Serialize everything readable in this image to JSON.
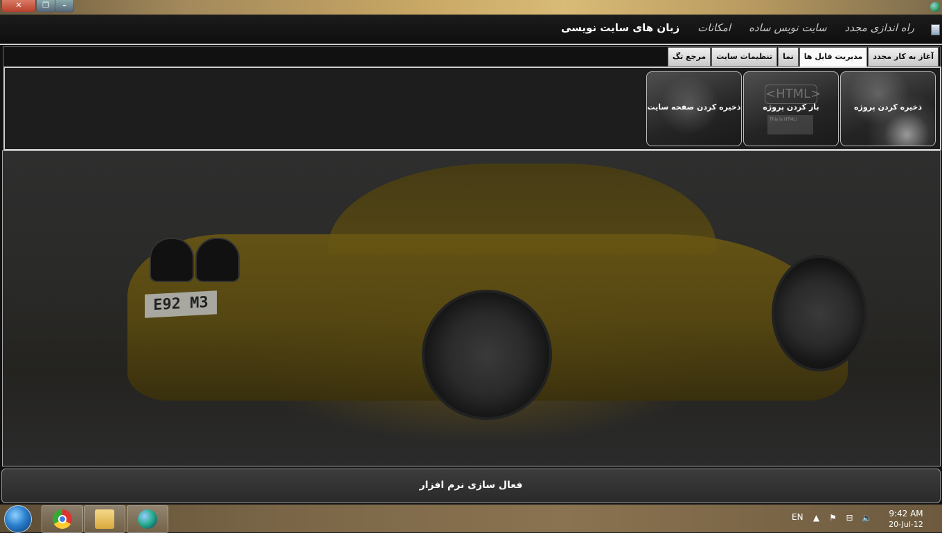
{
  "window": {
    "close_glyph": "✕",
    "restore_glyph": "❐",
    "minimize_glyph": "–"
  },
  "menu": {
    "items": [
      "زبان های سایت نویسی",
      "امکانات",
      "سایت نویس ساده",
      "راه اندازی مجدد"
    ]
  },
  "tabs": [
    "آغاز به کار مجدد",
    "مدیریت فایل ها",
    "نما",
    "تنظیمات سایت",
    "مرجع تگ"
  ],
  "active_tab_index": 1,
  "ribbon": {
    "tools": [
      {
        "label": "ذخیره کردن پروژه",
        "icon": "save-project-icon"
      },
      {
        "label": "باز کردن پروژه",
        "icon": "open-project-icon",
        "badge": "<HTML>",
        "note": "This is HTML!"
      },
      {
        "label": "ذخیره کردن صفحه سایت",
        "icon": "save-page-icon"
      }
    ]
  },
  "stage": {
    "plate_text": "E92 M3"
  },
  "activation": {
    "label": "فعال سازی نرم افزار"
  },
  "taskbar": {
    "apps": [
      "start-orb",
      "chrome-icon",
      "explorer-icon",
      "network-app-icon"
    ],
    "language": "EN",
    "tray_icons": [
      "up-arrow-icon",
      "flag-icon",
      "network-icon",
      "volume-icon"
    ],
    "time": "9:42 AM",
    "date": "20-Jul-12"
  },
  "colors": {
    "tab_bg": "#e2e2e2",
    "app_bg": "#111111",
    "accent_border": "#cfcfcf"
  }
}
